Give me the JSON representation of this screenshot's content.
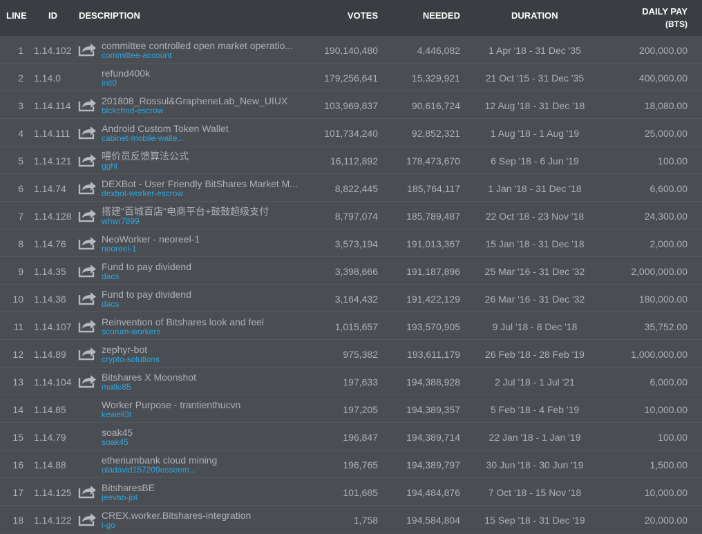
{
  "headers": {
    "line": "LINE",
    "id": "ID",
    "description": "DESCRIPTION",
    "votes": "VOTES",
    "needed": "NEEDED",
    "duration": "DURATION",
    "daily_pay": "DAILY PAY",
    "daily_pay_unit": "(BTS)"
  },
  "colors": {
    "background": "#4a4d52",
    "header_background": "#3a3d41",
    "text": "#aeb1b5",
    "account_link": "#2fa6e0"
  },
  "rows": [
    {
      "line": "1",
      "id": "1.14.102",
      "has_link": true,
      "description": "committee controlled open market operatio...",
      "account": "committee-account",
      "votes": "190,140,480",
      "needed": "4,446,082",
      "duration": "1 Apr '18 - 31 Dec '35",
      "daily_pay": "200,000.00"
    },
    {
      "line": "2",
      "id": "1.14.0",
      "has_link": false,
      "description": "refund400k",
      "account": "init0",
      "votes": "179,256,641",
      "needed": "15,329,921",
      "duration": "21 Oct '15 - 31 Dec '35",
      "daily_pay": "400,000.00"
    },
    {
      "line": "3",
      "id": "1.14.114",
      "has_link": true,
      "description": "201808_Rossul&GrapheneLab_New_UIUX",
      "account": "blckchnd-escrow",
      "votes": "103,969,837",
      "needed": "90,616,724",
      "duration": "12 Aug '18 - 31 Dec '18",
      "daily_pay": "18,080.00"
    },
    {
      "line": "4",
      "id": "1.14.111",
      "has_link": true,
      "description": "Android Custom Token Wallet",
      "account": "cabinet-mobile-walle...",
      "votes": "101,734,240",
      "needed": "92,852,321",
      "duration": "1 Aug '18 - 1 Aug '19",
      "daily_pay": "25,000.00"
    },
    {
      "line": "5",
      "id": "1.14.121",
      "has_link": true,
      "description": "喂价员反馈算法公式",
      "account": "gghi",
      "votes": "16,112,892",
      "needed": "178,473,670",
      "duration": "6 Sep '18 - 6 Jun '19",
      "daily_pay": "100.00"
    },
    {
      "line": "6",
      "id": "1.14.74",
      "has_link": true,
      "description": "DEXBot - User Friendly BitShares Market M...",
      "account": "dexbot-worker-escrow",
      "votes": "8,822,445",
      "needed": "185,764,117",
      "duration": "1 Jan '18 - 31 Dec '18",
      "daily_pay": "6,600.00"
    },
    {
      "line": "7",
      "id": "1.14.128",
      "has_link": true,
      "description": "搭建\"百城百店\"电商平台+鼓鼓超级支付",
      "account": "whwr7899",
      "votes": "8,797,074",
      "needed": "185,789,487",
      "duration": "22 Oct '18 - 23 Nov '18",
      "daily_pay": "24,300.00"
    },
    {
      "line": "8",
      "id": "1.14.76",
      "has_link": true,
      "description": "NeoWorker - neoreel-1",
      "account": "neoreel-1",
      "votes": "3,573,194",
      "needed": "191,013,367",
      "duration": "15 Jan '18 - 31 Dec '18",
      "daily_pay": "2,000.00"
    },
    {
      "line": "9",
      "id": "1.14.35",
      "has_link": true,
      "description": "Fund to pay dividend",
      "account": "dacs",
      "votes": "3,398,666",
      "needed": "191,187,896",
      "duration": "25 Mar '16 - 31 Dec '32",
      "daily_pay": "2,000,000.00"
    },
    {
      "line": "10",
      "id": "1.14.36",
      "has_link": true,
      "description": "Fund to pay dividend",
      "account": "dacs",
      "votes": "3,164,432",
      "needed": "191,422,129",
      "duration": "26 Mar '16 - 31 Dec '32",
      "daily_pay": "180,000.00"
    },
    {
      "line": "11",
      "id": "1.14.107",
      "has_link": true,
      "description": "Reinvention of Bitshares look and feel",
      "account": "scorum-workers",
      "votes": "1,015,657",
      "needed": "193,570,905",
      "duration": "9 Jul '18 - 8 Dec '18",
      "daily_pay": "35,752.00"
    },
    {
      "line": "12",
      "id": "1.14.89",
      "has_link": true,
      "description": "zephyr-bot",
      "account": "crypto-solutions",
      "votes": "975,382",
      "needed": "193,611,179",
      "duration": "26 Feb '18 - 28 Feb '19",
      "daily_pay": "1,000,000.00"
    },
    {
      "line": "13",
      "id": "1.14.104",
      "has_link": true,
      "description": "Bitshares X Moonshot",
      "account": "matle85",
      "votes": "197,633",
      "needed": "194,388,928",
      "duration": "2 Jul '18 - 1 Jul '21",
      "daily_pay": "6,000.00"
    },
    {
      "line": "14",
      "id": "1.14.85",
      "has_link": false,
      "description": "Worker Purpose - trantienthucvn",
      "account": "kewell3t",
      "votes": "197,205",
      "needed": "194,389,357",
      "duration": "5 Feb '18 - 4 Feb '19",
      "daily_pay": "10,000.00"
    },
    {
      "line": "15",
      "id": "1.14.79",
      "has_link": false,
      "description": "soak45",
      "account": "soak45",
      "votes": "196,847",
      "needed": "194,389,714",
      "duration": "22 Jan '18 - 1 Jan '19",
      "daily_pay": "100.00"
    },
    {
      "line": "16",
      "id": "1.14.88",
      "has_link": false,
      "description": "etheriumbank cloud mining",
      "account": "oladavid157209esseem...",
      "votes": "196,765",
      "needed": "194,389,797",
      "duration": "30 Jun '18 - 30 Jun '19",
      "daily_pay": "1,500.00"
    },
    {
      "line": "17",
      "id": "1.14.125",
      "has_link": true,
      "description": "BitsharesBE",
      "account": "jeevan-jot",
      "votes": "101,685",
      "needed": "194,484,876",
      "duration": "7 Oct '18 - 15 Nov '18",
      "daily_pay": "10,000.00"
    },
    {
      "line": "18",
      "id": "1.14.122",
      "has_link": true,
      "description": "CREX.worker.Bitshares-integration",
      "account": "i-go",
      "votes": "1,758",
      "needed": "194,584,804",
      "duration": "15 Sep '18 - 31 Dec '19",
      "daily_pay": "20,000.00"
    }
  ]
}
